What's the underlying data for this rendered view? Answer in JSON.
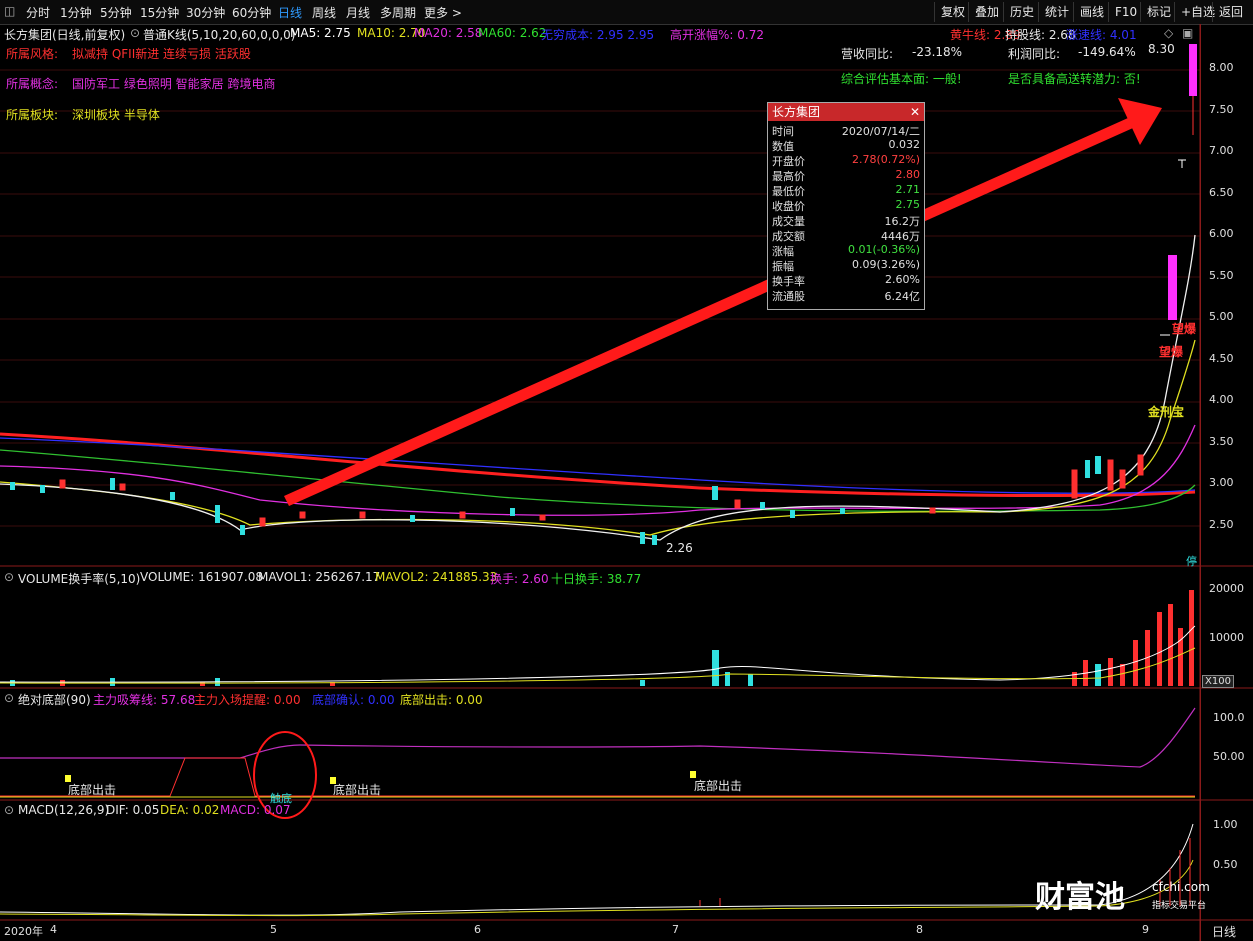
{
  "toolbar": {
    "periods": [
      "分时",
      "1分钟",
      "5分钟",
      "15分钟",
      "30分钟",
      "60分钟",
      "日线",
      "周线",
      "月线",
      "多周期",
      "更多 >"
    ],
    "active": "日线",
    "right": [
      "复权",
      "叠加",
      "历史",
      "统计",
      "画线",
      "F10",
      "标记",
      "+自选",
      "返回"
    ]
  },
  "main": {
    "title": "长方集团(日线,前复权)",
    "indicator": "普通K线(5,10,20,60,0,0,0)",
    "ma5": "MA5: 2.75",
    "ma10": "MA10: 2.70",
    "ma20": "MA20: 2.58",
    "ma60": "MA60: 2.62",
    "cost": "无穷成本: 2.95   2.95",
    "gap": "高开涨幅%: 0.72",
    "yellow": "黄牛线: 2.89",
    "hold": "持股线: 2.68",
    "fast": "涨速线: 4.01",
    "style_k": "所属风格:",
    "style_v": "拟减持 QFII新进 连续亏损 活跃股",
    "concept_k": "所属概念:",
    "concept_v": "国防军工 绿色照明 智能家居 跨境电商",
    "sector_k": "所属板块:",
    "sector_v": "深圳板块   半导体",
    "rev_k": "营收同比:",
    "rev_v": "-23.18%",
    "profit_k": "利润同比:",
    "profit_v": "-149.64%",
    "eval": "综合评估基本面: 一般!",
    "transfer": "是否具备高送转潜力: 否!",
    "top_price": "8.30",
    "low_price": "2.26",
    "sig1": "望爆",
    "sig2": "望爆",
    "sig3": "金刑宝",
    "stop": "停"
  },
  "popup": {
    "title": "长方集团",
    "rows": [
      {
        "k": "时间",
        "v": "2020/07/14/二",
        "c": "#e0e0e0"
      },
      {
        "k": "数值",
        "v": "0.032",
        "c": "#e0e0e0"
      },
      {
        "k": "开盘价",
        "v": "2.78(0.72%)",
        "c": "#ff4040"
      },
      {
        "k": "最高价",
        "v": "2.80",
        "c": "#ff4040"
      },
      {
        "k": "最低价",
        "v": "2.71",
        "c": "#40e040"
      },
      {
        "k": "收盘价",
        "v": "2.75",
        "c": "#40e040"
      },
      {
        "k": "成交量",
        "v": "16.2万",
        "c": "#e0e0e0"
      },
      {
        "k": "成交额",
        "v": "4446万",
        "c": "#e0e0e0"
      },
      {
        "k": "涨幅",
        "v": "0.01(-0.36%)",
        "c": "#40e040"
      },
      {
        "k": "振幅",
        "v": "0.09(3.26%)",
        "c": "#e0e0e0"
      },
      {
        "k": "换手率",
        "v": "2.60%",
        "c": "#e0e0e0"
      },
      {
        "k": "流通股",
        "v": "6.24亿",
        "c": "#e0e0e0"
      }
    ]
  },
  "axis_main": [
    "8.00",
    "7.50",
    "7.00",
    "6.50",
    "6.00",
    "5.50",
    "5.00",
    "4.50",
    "4.00",
    "3.50",
    "3.00",
    "2.50"
  ],
  "volume": {
    "title": "VOLUME换手率(5,10)",
    "vol": "VOLUME: 161907.08",
    "mavol1": "MAVOL1: 256267.17",
    "mavol2": "MAVOL2: 241885.33",
    "turn": "换手: 2.60",
    "turn10": "十日换手: 38.77",
    "axis": [
      "20000",
      "10000"
    ],
    "unit": "X100"
  },
  "bottom": {
    "title": "绝对底部(90)",
    "l1": "主力吸筹线: 57.68",
    "l2": "主力入场提醒: 0.00",
    "l3": "底部确认: 0.00",
    "l4": "底部出击: 0.00",
    "m1": "底部出击",
    "m2": "底部出击",
    "m3": "底部出击",
    "m4": "触底",
    "axis": [
      "100.0",
      "50.00"
    ]
  },
  "macd": {
    "title": "MACD(12,26,9)",
    "dif": "DIF: 0.05",
    "dea": "DEA: 0.02",
    "macd": "MACD: 0.07",
    "axis": [
      "1.00",
      "0.50"
    ]
  },
  "dates": [
    "2020年",
    "4",
    "5",
    "6",
    "7",
    "8",
    "9"
  ],
  "period_label": "日线",
  "watermark": {
    "brand": "财富池",
    "site": "cfchi.com",
    "slogan": "指标交易平台"
  }
}
